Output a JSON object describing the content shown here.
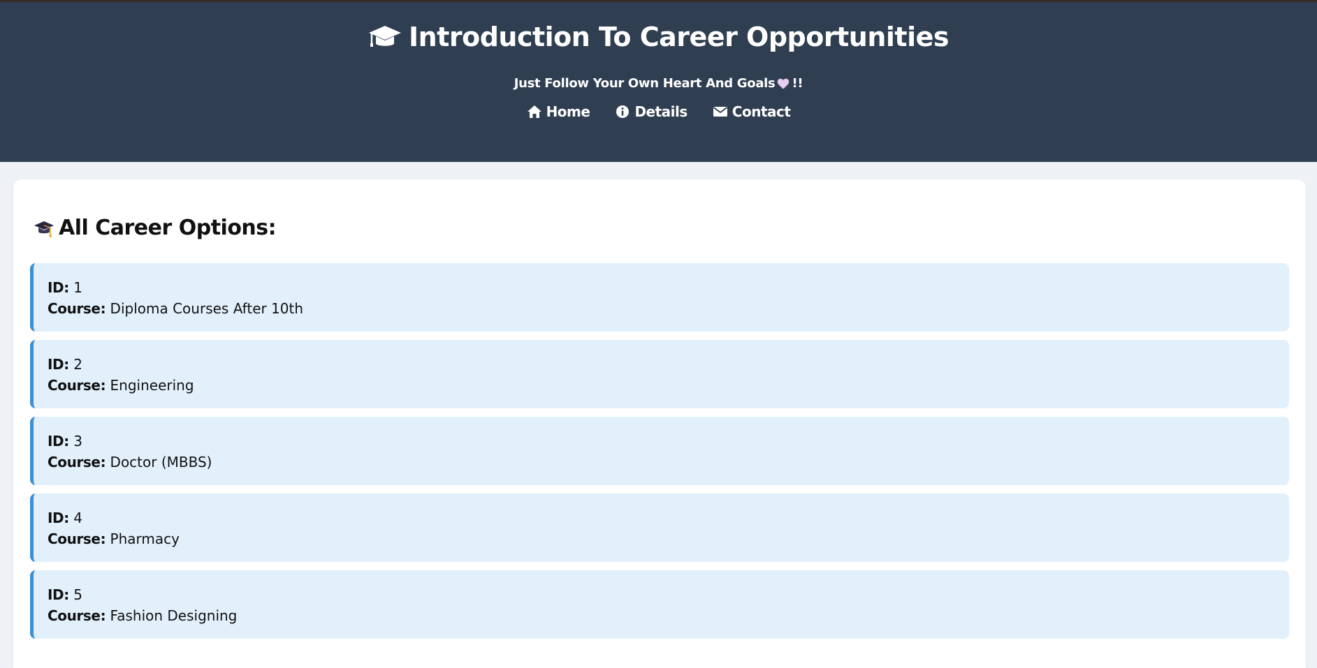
{
  "header": {
    "title": "Introduction To Career Opportunities",
    "tagline": "Just Follow Your Own Heart And Goals",
    "tagline_suffix": "!!",
    "nav": [
      {
        "label": "Home",
        "icon": "home-icon"
      },
      {
        "label": "Details",
        "icon": "info-icon"
      },
      {
        "label": "Contact",
        "icon": "envelope-icon"
      }
    ]
  },
  "main": {
    "section_title": "All Career Options:",
    "id_label": "ID:",
    "course_label": "Course:",
    "items": [
      {
        "id": "1",
        "course": "Diploma Courses After 10th"
      },
      {
        "id": "2",
        "course": "Engineering"
      },
      {
        "id": "3",
        "course": "Doctor (MBBS)"
      },
      {
        "id": "4",
        "course": "Pharmacy"
      },
      {
        "id": "5",
        "course": "Fashion Designing"
      }
    ]
  },
  "colors": {
    "header_bg": "#2f3e51",
    "card_bg": "#e2f0fc",
    "card_accent": "#3a8fd6",
    "page_bg": "#eef2f7"
  }
}
